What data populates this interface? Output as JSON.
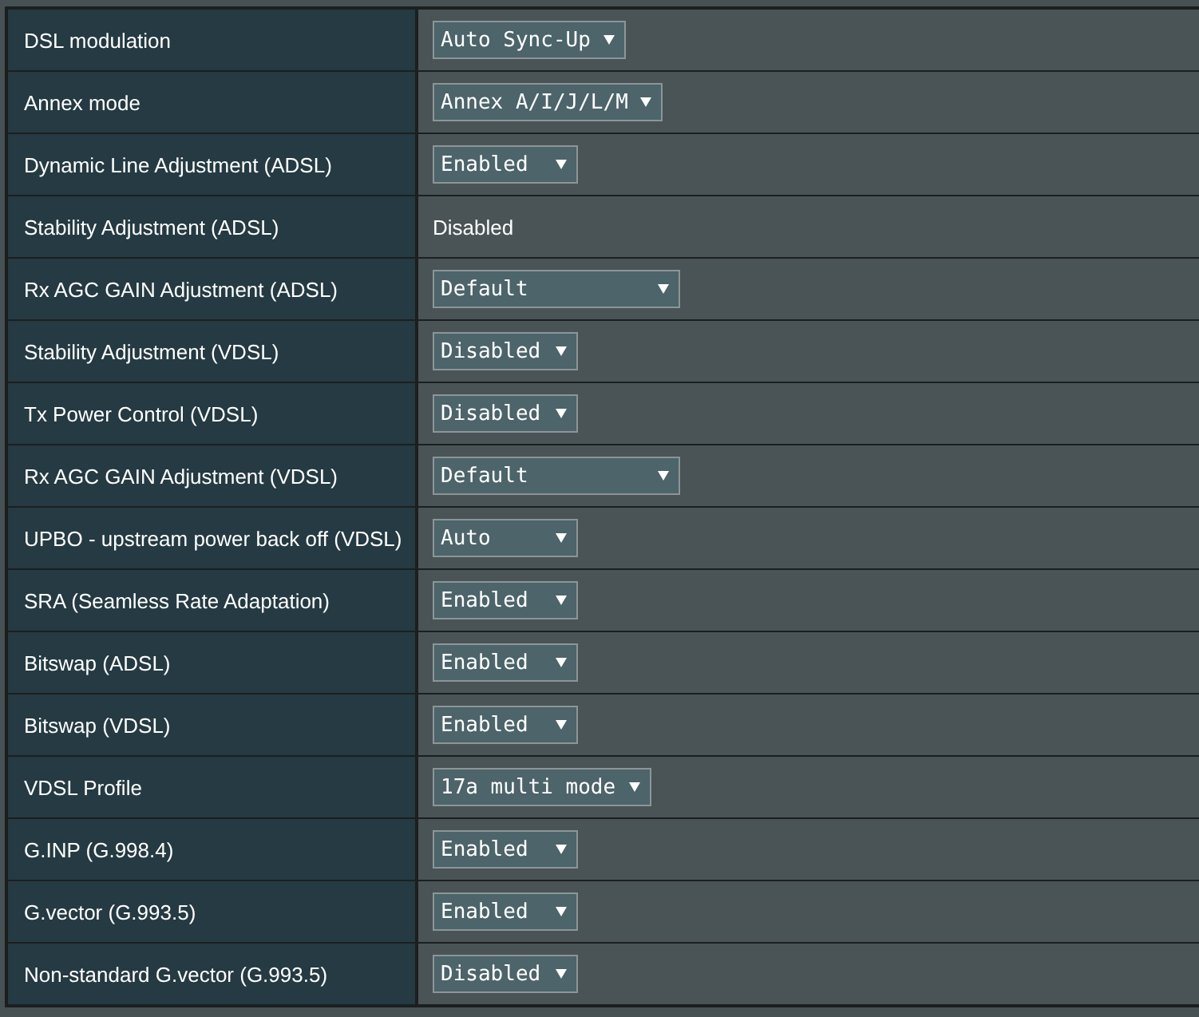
{
  "settings": [
    {
      "label": "DSL modulation",
      "kind": "select",
      "value": "Auto Sync-Up"
    },
    {
      "label": "Annex mode",
      "kind": "select",
      "value": "Annex A/I/J/L/M"
    },
    {
      "label": "Dynamic Line Adjustment (ADSL)",
      "kind": "select",
      "value": "Enabled"
    },
    {
      "label": "Stability Adjustment (ADSL)",
      "kind": "text",
      "value": "Disabled"
    },
    {
      "label": "Rx AGC GAIN Adjustment (ADSL)",
      "kind": "wide-select",
      "value": "Default"
    },
    {
      "label": "Stability Adjustment (VDSL)",
      "kind": "select",
      "value": "Disabled"
    },
    {
      "label": "Tx Power Control (VDSL)",
      "kind": "select",
      "value": "Disabled"
    },
    {
      "label": "Rx AGC GAIN Adjustment (VDSL)",
      "kind": "wide-select",
      "value": "Default"
    },
    {
      "label": "UPBO - upstream power back off (VDSL)",
      "kind": "select",
      "value": "Auto"
    },
    {
      "label": "SRA (Seamless Rate Adaptation)",
      "kind": "select",
      "value": "Enabled"
    },
    {
      "label": "Bitswap (ADSL)",
      "kind": "select",
      "value": "Enabled"
    },
    {
      "label": "Bitswap (VDSL)",
      "kind": "select",
      "value": "Enabled"
    },
    {
      "label": "VDSL Profile",
      "kind": "select",
      "value": "17a multi mode"
    },
    {
      "label": "G.INP (G.998.4)",
      "kind": "select",
      "value": "Enabled"
    },
    {
      "label": "G.vector (G.993.5)",
      "kind": "select",
      "value": "Enabled"
    },
    {
      "label": "Non-standard G.vector (G.993.5)",
      "kind": "select",
      "value": "Disabled"
    }
  ]
}
